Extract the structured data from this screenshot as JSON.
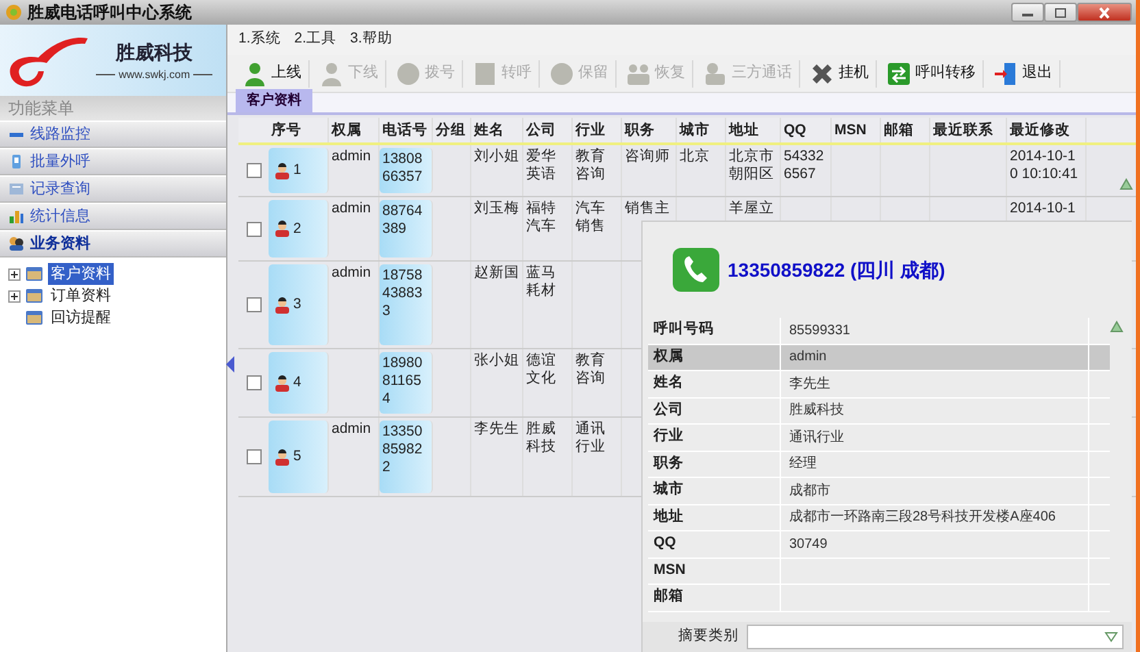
{
  "window": {
    "title": "胜威电话呼叫中心系统"
  },
  "logo": {
    "name": "胜威科技",
    "url": "www.swkj.com"
  },
  "sidebar": {
    "header": "功能菜单",
    "items": [
      {
        "label": "线路监控",
        "selected": false
      },
      {
        "label": "批量外呼",
        "selected": false
      },
      {
        "label": "记录查询",
        "selected": false
      },
      {
        "label": "统计信息",
        "selected": false
      },
      {
        "label": "业务资料",
        "selected": true
      }
    ],
    "tree": [
      {
        "label": "客户资料",
        "selected": true,
        "expandable": true
      },
      {
        "label": "订单资料",
        "selected": false,
        "expandable": true
      },
      {
        "label": "回访提醒",
        "selected": false,
        "expandable": false
      }
    ]
  },
  "menu": [
    "1.系统",
    "2.工具",
    "3.帮助"
  ],
  "toolbar": [
    {
      "label": "上线",
      "disabled": false
    },
    {
      "label": "下线",
      "disabled": true
    },
    {
      "label": "拨号",
      "disabled": true
    },
    {
      "label": "转呼",
      "disabled": true
    },
    {
      "label": "保留",
      "disabled": true
    },
    {
      "label": "恢复",
      "disabled": true
    },
    {
      "label": "三方通话",
      "disabled": true
    },
    {
      "label": "挂机",
      "disabled": false
    },
    {
      "label": "呼叫转移",
      "disabled": false
    },
    {
      "label": "退出",
      "disabled": false
    }
  ],
  "tabs": [
    {
      "label": "客户资料",
      "selected": true
    }
  ],
  "table": {
    "columns": [
      "序号",
      "权属",
      "电话号",
      "分组",
      "姓名",
      "公司",
      "行业",
      "职务",
      "城市",
      "地址",
      "QQ",
      "MSN",
      "邮箱",
      "最近联系",
      "最近修改"
    ],
    "rows": [
      {
        "checked": false,
        "cells": [
          "1",
          "admin",
          "1380866357",
          null,
          "刘小姐",
          "爱华英语",
          "教育咨询",
          "咨询师",
          "北京",
          "北京市朝阳区",
          "543326567",
          null,
          null,
          null,
          "2014-10-10 10:10:41"
        ]
      },
      {
        "checked": false,
        "cells": [
          "2",
          "admin",
          "88764389",
          null,
          "刘玉梅",
          "福特汽车",
          "汽车销售",
          "销售主",
          null,
          "羊屋立",
          null,
          null,
          null,
          null,
          "2014-10-1"
        ]
      },
      {
        "checked": false,
        "cells": [
          "3",
          "admin",
          "18758438833",
          null,
          "赵新国",
          "蓝马耗材"
        ]
      },
      {
        "checked": false,
        "cells": [
          "4",
          null,
          "18980811654",
          null,
          "张小姐",
          "德谊文化",
          "教育咨询"
        ]
      },
      {
        "checked": false,
        "cells": [
          "5",
          "admin",
          "13350859822",
          null,
          "李先生",
          "胜威科技",
          "通讯行业"
        ]
      }
    ]
  },
  "caller_popup": {
    "heading": "13350859822 (四川 成都)",
    "fields": [
      {
        "label": "呼叫号码",
        "value": "85599331",
        "selected": false
      },
      {
        "label": "权属",
        "value": "admin",
        "selected": true
      },
      {
        "label": "姓名",
        "value": "李先生",
        "selected": false
      },
      {
        "label": "公司",
        "value": "胜威科技",
        "selected": false
      },
      {
        "label": "行业",
        "value": "通讯行业",
        "selected": false
      },
      {
        "label": "职务",
        "value": "经理",
        "selected": false
      },
      {
        "label": "城市",
        "value": "成都市",
        "selected": false
      },
      {
        "label": "地址",
        "value": "成都市一环路南三段28号科技开发楼A座406",
        "selected": false
      },
      {
        "label": "QQ",
        "value": "30749",
        "selected": false
      },
      {
        "label": "MSN",
        "selected": false
      },
      {
        "label": "邮箱",
        "selected": false
      }
    ],
    "summary_label": "摘要类别"
  }
}
